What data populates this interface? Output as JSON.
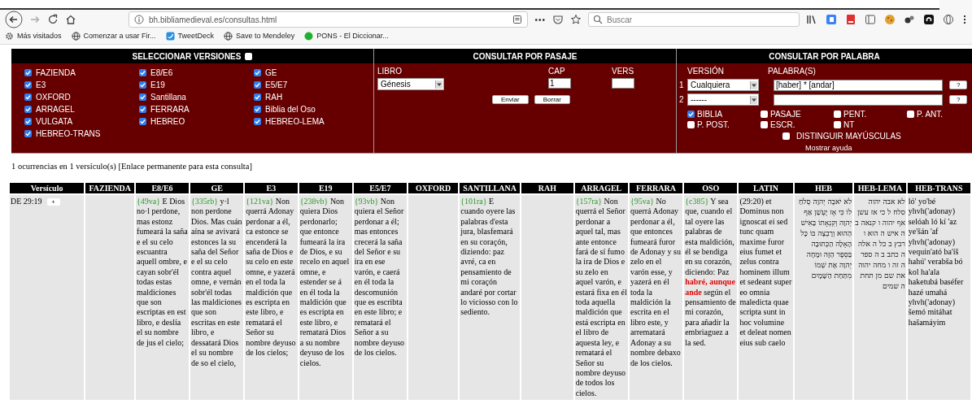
{
  "browser": {
    "url": "bh.bibliamedieval.es/consultas.html",
    "search_placeholder": "Buscar",
    "more": "•••",
    "bookmarks": [
      "Más visitados",
      "Comenzar a usar Fir...",
      "TweetDeck",
      "Save to Mendeley",
      "PONS - El Diccionar..."
    ]
  },
  "versions": {
    "title": "SELECCIONAR VERSIONES",
    "all_checked": false,
    "items": [
      {
        "label": "FAZIENDA",
        "checked": true
      },
      {
        "label": "E8/E6",
        "checked": true
      },
      {
        "label": "GE",
        "checked": true
      },
      {
        "label": "E3",
        "checked": true
      },
      {
        "label": "E19",
        "checked": true
      },
      {
        "label": "E5/E7",
        "checked": true
      },
      {
        "label": "OXFORD",
        "checked": true
      },
      {
        "label": "Santillana",
        "checked": true
      },
      {
        "label": "RAH",
        "checked": true
      },
      {
        "label": "ARRAGEL",
        "checked": true
      },
      {
        "label": "FERRARA",
        "checked": true
      },
      {
        "label": "Biblia del Oso",
        "checked": true
      },
      {
        "label": "VULGATA",
        "checked": true
      },
      {
        "label": "HEBREO",
        "checked": true
      },
      {
        "label": "HEBREO-LEMA",
        "checked": true
      },
      {
        "label": "HEBREO-TRANS",
        "checked": true
      }
    ]
  },
  "passage": {
    "title": "CONSULTAR POR PASAJE",
    "book_label": "LIBRO",
    "book": "Génesis",
    "chapter_label": "CAP",
    "chapter": "1",
    "verse_label": "VERS",
    "buttons": [
      "Enviar",
      "Borrar"
    ]
  },
  "word": {
    "title": "CONSULTAR POR PALABRA",
    "version_label": "VERSIÓN",
    "words_label": "PALABRA(S)",
    "rows": [
      {
        "number": "1",
        "version": "Cualquiera",
        "words": "[haber] * [andar]",
        "help": "?"
      },
      {
        "number": "2",
        "version": "------",
        "help": "?"
      }
    ],
    "scopes": [
      {
        "label": "BIBLIA",
        "checked": true
      },
      {
        "label": "PASAJE",
        "checked": false
      },
      {
        "label": "PENT.",
        "checked": false
      },
      {
        "label": "P. ANT.",
        "checked": false
      },
      {
        "label": "P. POST.",
        "checked": false
      },
      {
        "label": "ESCR.",
        "checked": false
      },
      {
        "label": "NT",
        "checked": false
      }
    ],
    "case": {
      "label": "DISTINGUIR MAYÚSCULAS",
      "checked": false
    },
    "help_link": "Mostrar ayuda"
  },
  "summary": "1 ocurrencias en 1 versículo(s) [Enlace permanente para esta consulta]",
  "table": {
    "verse_column": "Versículo",
    "columns": [
      "FAZIENDA",
      "E8/E6",
      "GE",
      "E3",
      "E19",
      "E5/E7",
      "OXFORD",
      "SANTILLANA",
      "RAH",
      "ARRAGEL",
      "FERRARA",
      "OSO",
      "LATIN",
      "HEB",
      "HEB-LEMA",
      "HEB-TRANS"
    ],
    "rows": [
      {
        "verse": "DE 29:19",
        "expand": "+",
        "cells": [
          "",
          {
            "parts": [
              {
                "kind": "ref",
                "text": "{49va}"
              },
              {
                "kind": "text",
                "text": "E Dios no·l perdone, mas estonz fumeará la saña e el su celo escuantra aquell ombre, e cayan sobr'él todas estas maldiciones que son escriptas en est libro, e deslía el su nombre de jus el cielo;"
              }
            ]
          },
          {
            "parts": [
              {
                "kind": "ref",
                "text": "{335rb}"
              },
              {
                "kind": "text",
                "text": "y·l non perdone Dios. Mas cuán aína se avivará estonces la su saña del Señor e el su celo contra aquel omne, e vernán sobr'él todas las maldiciones que son escritas en este libro, e dessatará Dios el su nombre de so el cielo,"
              }
            ]
          },
          {
            "parts": [
              {
                "kind": "ref",
                "text": "{121va}"
              },
              {
                "kind": "text",
                "text": "Non querrá Adonay perdonar a él, ca estonce se encenderá la saña de Dios e su celo en este omne, e yazerá en el toda la maldición que es escripta en este libro, e rematará el Señor su nombre deyuso de los cielos;"
              }
            ]
          },
          {
            "parts": [
              {
                "kind": "ref",
                "text": "{238vb}"
              },
              {
                "kind": "text",
                "text": "Non quiera Dios perdonarlo; que entonce fumeará la ira de Dios, e su recelo en aquel omne, e estender se á en él toda la maldición que es escripta en este libro, e rematará Dios a su nombre deyuso de los cielos."
              }
            ]
          },
          {
            "parts": [
              {
                "kind": "ref",
                "text": "{93vb}"
              },
              {
                "kind": "text",
                "text": "Non quiera el Señor perdonar a él; mas entonces crecerá la saña del Señor e su ira en ese varón, e caerá en él toda la descomunión que es escribta en este libro; e rematará el Señor a su nombre deyuso de los cielos."
              }
            ]
          },
          "",
          {
            "parts": [
              {
                "kind": "ref",
                "text": "{101ra}"
              },
              {
                "kind": "text",
                "text": "E cuando oyere las palabras d'esta jura, blasfemará en su coraçón, diziendo: paz avré, ca en pensamiento de mi coraçón andaré por cortar lo viciosso con lo sediento."
              }
            ]
          },
          "",
          {
            "parts": [
              {
                "kind": "ref",
                "text": "{157ra}"
              },
              {
                "kind": "text",
                "text": "Non querrá el Señor perdonar a aquel tal, mas ante entonce fará de sí fumo la ira de Dios e su zelo en aquel varón, e estará fixa en él toda aquella maldición que está escripta en el libro de aquesta ley, e rematará el Señor su nombre deyuso de todos los cielos."
              }
            ]
          },
          {
            "parts": [
              {
                "kind": "ref",
                "text": "{95va}"
              },
              {
                "kind": "text",
                "text": "No querrá Adonay perdonar a él, que entonces fumeará furor de Adonay y su zelo en el varón esse, y yazerá en él toda la maldición la escrita en el libro este, y arrematará Adonay a su nombre debaxo de los cielos."
              }
            ]
          },
          {
            "parts": [
              {
                "kind": "ref",
                "text": "{c385}"
              },
              {
                "kind": "text",
                "text": "Y sea que, cuando el tal oyere las palabras de esta maldición, él se bendiga en su corazón, diciendo: Paz"
              },
              {
                "kind": "match",
                "text": "habré, aunque ande"
              },
              {
                "kind": "text",
                "text": "según el pensamiento de mi corazón, para añadir la embriaguez a la sed."
              }
            ]
          },
          {
            "parts": [
              {
                "kind": "text",
                "text": "(29:20) et Dominus non ignoscat ei sed tunc quam maxime furor eius fumet et zelus contra hominem illum et sedeant super eo omnia maledicta quae scripta sunt in hoc volumine et deleat nomen eius sub caelo"
              }
            ]
          },
          {
            "parts": [
              {
                "kind": "hebrew",
                "text": "לֹא יֹאבֶה יְהוָה סְלֹחַ לוֹ כִּי אָז יֶעְשַׁן אַף יְהוָה וְקִנְאָתוֹ בָּאִישׁ הַהוּא וְרָבְצָה בּוֹ כָּל הָאָלָה הַכְּתוּבָה בַּסֵּפֶר הַזֶּה וּמָחָה יְהוָה אֶת שְׁמוֹ מִתַּחַת הַשָּׁמָיִם"
              }
            ]
          },
          {
            "parts": [
              {
                "kind": "hebrew",
                "text": "לא אבה יהוה סלח ל כי אז עשן אף יהוה ו קנאה ב ה איש ה הוא ו רבץ ב כל ה אלה ה כתב ב ה ספר ה זה ו מחה יהוה את שם מן תחת ה שמים"
              }
            ]
          },
          {
            "parts": [
              {
                "kind": "text",
                "text": "ló' yo'bé yhvh('adonay) selóah ló kí 'az ye'šán 'af yhvh('adonay) vequin'ató ba'íš hahú' verabša bó kol ha'ala haketubá baséfer hazé umahá yhvh('adonay) šemó mitáhat hašamáyim"
              }
            ]
          }
        ]
      }
    ]
  }
}
